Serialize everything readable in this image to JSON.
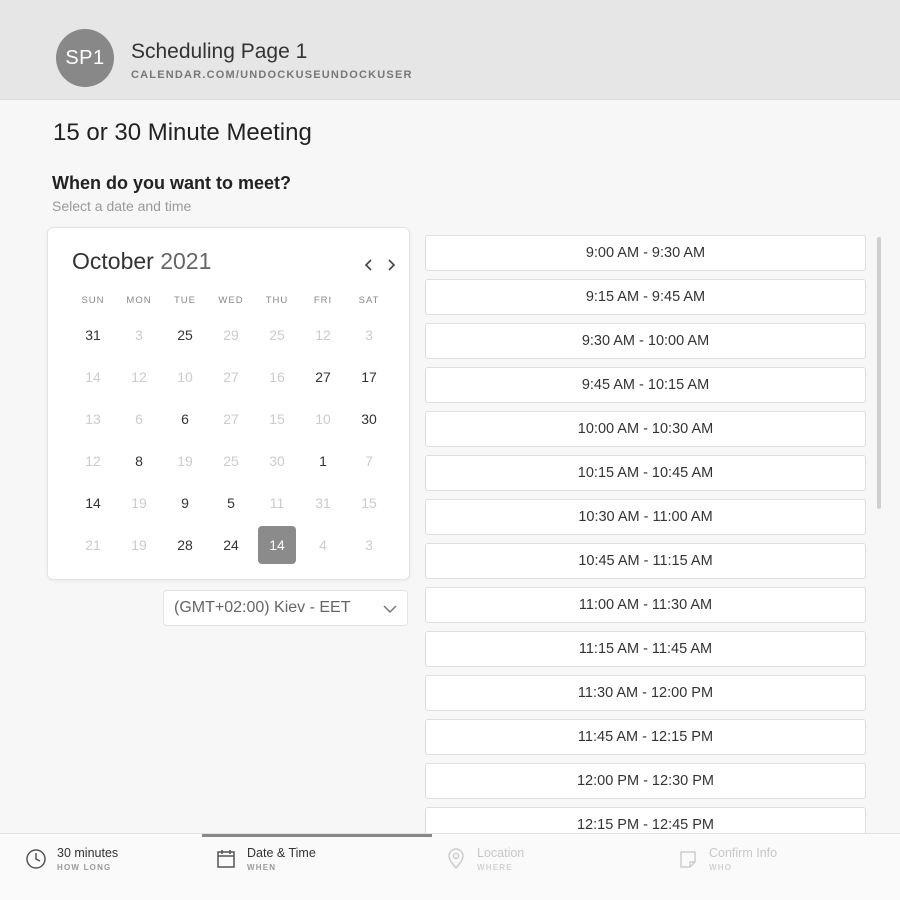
{
  "header": {
    "avatar_initials": "SP1",
    "page_name": "Scheduling Page 1",
    "page_url": "CALENDAR.COM/UNDOCKUSEUNDOCKUSER"
  },
  "meeting_title": "15 or 30 Minute Meeting",
  "prompt": {
    "question": "When do you want to meet?",
    "subtitle": "Select a date and time"
  },
  "calendar": {
    "month": "October",
    "year": "2021",
    "weekdays": [
      "SUN",
      "MON",
      "TUE",
      "WED",
      "THU",
      "FRI",
      "SAT"
    ],
    "days": [
      {
        "n": "31",
        "s": "available"
      },
      {
        "n": "3",
        "s": "disabled"
      },
      {
        "n": "25",
        "s": "available"
      },
      {
        "n": "29",
        "s": "disabled"
      },
      {
        "n": "25",
        "s": "disabled"
      },
      {
        "n": "12",
        "s": "disabled"
      },
      {
        "n": "3",
        "s": "disabled"
      },
      {
        "n": "14",
        "s": "disabled"
      },
      {
        "n": "12",
        "s": "disabled"
      },
      {
        "n": "10",
        "s": "disabled"
      },
      {
        "n": "27",
        "s": "disabled"
      },
      {
        "n": "16",
        "s": "disabled"
      },
      {
        "n": "27",
        "s": "available"
      },
      {
        "n": "17",
        "s": "available"
      },
      {
        "n": "13",
        "s": "disabled"
      },
      {
        "n": "6",
        "s": "disabled"
      },
      {
        "n": "6",
        "s": "available"
      },
      {
        "n": "27",
        "s": "disabled"
      },
      {
        "n": "15",
        "s": "disabled"
      },
      {
        "n": "10",
        "s": "disabled"
      },
      {
        "n": "30",
        "s": "available"
      },
      {
        "n": "12",
        "s": "disabled"
      },
      {
        "n": "8",
        "s": "available"
      },
      {
        "n": "19",
        "s": "disabled"
      },
      {
        "n": "25",
        "s": "disabled"
      },
      {
        "n": "30",
        "s": "disabled"
      },
      {
        "n": "1",
        "s": "available"
      },
      {
        "n": "7",
        "s": "disabled"
      },
      {
        "n": "14",
        "s": "available"
      },
      {
        "n": "19",
        "s": "disabled"
      },
      {
        "n": "9",
        "s": "available"
      },
      {
        "n": "5",
        "s": "available"
      },
      {
        "n": "11",
        "s": "disabled"
      },
      {
        "n": "31",
        "s": "disabled"
      },
      {
        "n": "15",
        "s": "disabled"
      },
      {
        "n": "21",
        "s": "disabled"
      },
      {
        "n": "19",
        "s": "disabled"
      },
      {
        "n": "28",
        "s": "available"
      },
      {
        "n": "24",
        "s": "available"
      },
      {
        "n": "14",
        "s": "selected"
      },
      {
        "n": "4",
        "s": "disabled"
      },
      {
        "n": "3",
        "s": "disabled"
      }
    ]
  },
  "timezone": {
    "selected": "(GMT+02:00) Kiev - EET"
  },
  "time_slots": [
    "9:00 AM - 9:30 AM",
    "9:15 AM - 9:45 AM",
    "9:30 AM - 10:00 AM",
    "9:45 AM - 10:15 AM",
    "10:00 AM - 10:30 AM",
    "10:15 AM - 10:45 AM",
    "10:30 AM - 11:00 AM",
    "10:45 AM - 11:15 AM",
    "11:00 AM - 11:30 AM",
    "11:15 AM - 11:45 AM",
    "11:30 AM - 12:00 PM",
    "11:45 AM - 12:15 PM",
    "12:00 PM - 12:30 PM",
    "12:15 PM - 12:45 PM"
  ],
  "steps": [
    {
      "label": "30 minutes",
      "sub": "HOW LONG",
      "icon": "clock-icon",
      "state": "done"
    },
    {
      "label": "Date & Time",
      "sub": "WHEN",
      "icon": "calendar-icon",
      "state": "active"
    },
    {
      "label": "Location",
      "sub": "WHERE",
      "icon": "location-pin-icon",
      "state": "pending"
    },
    {
      "label": "Confirm Info",
      "sub": "WHO",
      "icon": "note-icon",
      "state": "pending"
    }
  ]
}
